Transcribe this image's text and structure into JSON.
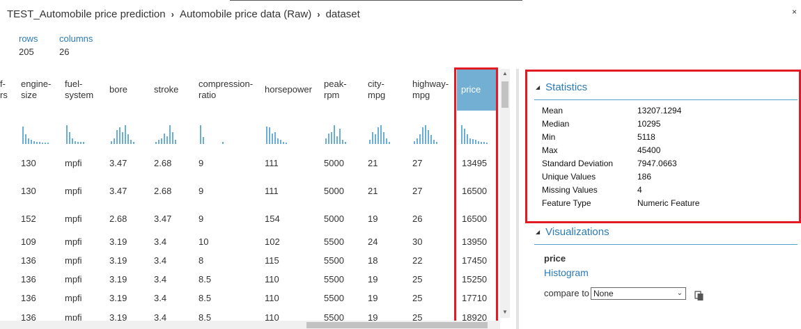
{
  "breadcrumb": {
    "items": [
      "TEST_Automobile price prediction",
      "Automobile price data (Raw)",
      "dataset"
    ],
    "separator": "›"
  },
  "close_icon": "×",
  "summary": {
    "rows_label": "rows",
    "rows_value": "205",
    "columns_label": "columns",
    "columns_value": "26"
  },
  "grid": {
    "partial_header": [
      "f-",
      "rs"
    ],
    "columns": [
      {
        "name": "engine-size",
        "lines": [
          "engine-",
          "size"
        ]
      },
      {
        "name": "fuel-system",
        "lines": [
          "fuel-",
          "system"
        ]
      },
      {
        "name": "bore",
        "lines": [
          "bore"
        ]
      },
      {
        "name": "stroke",
        "lines": [
          "stroke"
        ]
      },
      {
        "name": "compression-ratio",
        "lines": [
          "compression-",
          "ratio"
        ]
      },
      {
        "name": "horsepower",
        "lines": [
          "horsepower"
        ]
      },
      {
        "name": "peak-rpm",
        "lines": [
          "peak-",
          "rpm"
        ]
      },
      {
        "name": "city-mpg",
        "lines": [
          "city-",
          "mpg"
        ]
      },
      {
        "name": "highway-mpg",
        "lines": [
          "highway-",
          "mpg"
        ]
      },
      {
        "name": "price",
        "lines": [
          "price"
        ],
        "selected": true
      }
    ],
    "histograms": [
      [
        0.9,
        0.5,
        0.3,
        0.2,
        0.15,
        0.1,
        0.1,
        0.05,
        0.05,
        0.04
      ],
      [
        0.95,
        0.6,
        0.3,
        0.15,
        0.12,
        0.1,
        0.1
      ],
      [
        0.15,
        0.3,
        0.7,
        0.85,
        0.6,
        0.95,
        0.5,
        0.2,
        0.1
      ],
      [
        0.1,
        0.2,
        0.3,
        0.55,
        0.4,
        0.95,
        0.6,
        0.2
      ],
      [
        0.95,
        0.35,
        0.0,
        0.0,
        0.0,
        0.0,
        0.0,
        0.0,
        0.12
      ],
      [
        0.9,
        0.85,
        0.55,
        0.6,
        0.3,
        0.2,
        0.1,
        0.05
      ],
      [
        0.3,
        0.55,
        0.6,
        0.95,
        0.4,
        0.8,
        0.2,
        0.1
      ],
      [
        0.2,
        0.6,
        0.5,
        0.85,
        0.95,
        0.6,
        0.3,
        0.1
      ],
      [
        0.15,
        0.3,
        0.5,
        0.85,
        0.95,
        0.7,
        0.45,
        0.2,
        0.1
      ],
      [
        0.95,
        0.8,
        0.5,
        0.3,
        0.25,
        0.2,
        0.15,
        0.1,
        0.1,
        0.05
      ]
    ],
    "rows": [
      [
        "130",
        "mpfi",
        "3.47",
        "2.68",
        "9",
        "111",
        "5000",
        "21",
        "27",
        "13495"
      ],
      [
        "130",
        "mpfi",
        "3.47",
        "2.68",
        "9",
        "111",
        "5000",
        "21",
        "27",
        "16500"
      ],
      [
        "152",
        "mpfi",
        "2.68",
        "3.47",
        "9",
        "154",
        "5000",
        "19",
        "26",
        "16500"
      ],
      [
        "109",
        "mpfi",
        "3.19",
        "3.4",
        "10",
        "102",
        "5500",
        "24",
        "30",
        "13950"
      ],
      [
        "136",
        "mpfi",
        "3.19",
        "3.4",
        "8",
        "115",
        "5500",
        "18",
        "22",
        "17450"
      ],
      [
        "136",
        "mpfi",
        "3.19",
        "3.4",
        "8.5",
        "110",
        "5500",
        "19",
        "25",
        "15250"
      ],
      [
        "136",
        "mpfi",
        "3.19",
        "3.4",
        "8.5",
        "110",
        "5500",
        "19",
        "25",
        "17710"
      ],
      [
        "136",
        "mpfi",
        "3.19",
        "3.4",
        "8.5",
        "110",
        "5500",
        "19",
        "25",
        "18920"
      ]
    ]
  },
  "statistics": {
    "title": "Statistics",
    "items": [
      {
        "label": "Mean",
        "value": "13207.1294"
      },
      {
        "label": "Median",
        "value": "10295"
      },
      {
        "label": "Min",
        "value": "5118"
      },
      {
        "label": "Max",
        "value": "45400"
      },
      {
        "label": "Standard Deviation",
        "value": "7947.0663"
      },
      {
        "label": "Unique Values",
        "value": "186"
      },
      {
        "label": "Missing Values",
        "value": "4"
      },
      {
        "label": "Feature Type",
        "value": "Numeric Feature"
      }
    ]
  },
  "visualizations": {
    "title": "Visualizations",
    "feature": "price",
    "link": "Histogram",
    "compare_label": "compare to",
    "compare_value": "None"
  },
  "colors": {
    "accent": "#2a7ab5",
    "selected_header": "#72afd2",
    "histogram_bar": "#6aaed6",
    "highlight_box": "#e11a23"
  }
}
